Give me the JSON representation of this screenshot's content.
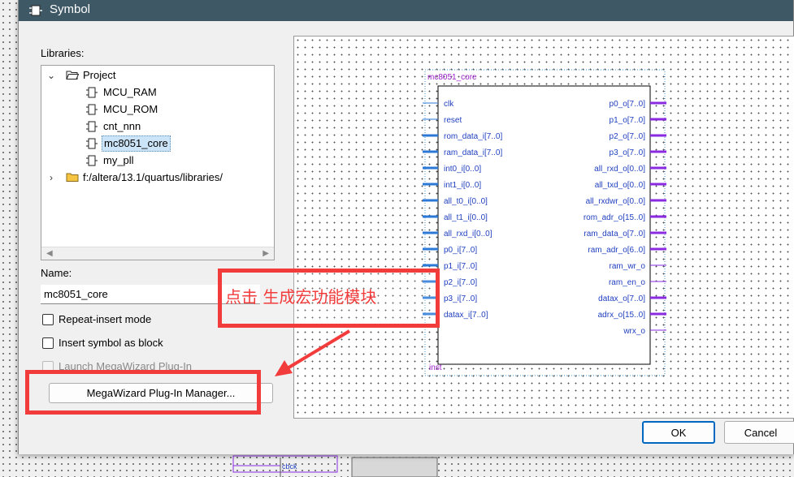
{
  "window": {
    "title": "Symbol"
  },
  "libraries": {
    "label": "Libraries:",
    "tree": [
      {
        "label": "Project",
        "kind": "folder",
        "expanded": true,
        "level": 0
      },
      {
        "label": "MCU_RAM",
        "kind": "symbol",
        "level": 1
      },
      {
        "label": "MCU_ROM",
        "kind": "symbol",
        "level": 1
      },
      {
        "label": "cnt_nnn",
        "kind": "symbol",
        "level": 1
      },
      {
        "label": "mc8051_core",
        "kind": "symbol",
        "level": 1,
        "selected": true
      },
      {
        "label": "my_pll",
        "kind": "symbol",
        "level": 1
      },
      {
        "label": "f:/altera/13.1/quartus/libraries/",
        "kind": "folder",
        "expanded": false,
        "level": 0
      }
    ]
  },
  "name_field": {
    "label": "Name:",
    "value": "mc8051_core"
  },
  "options": {
    "repeat_insert": "Repeat-insert mode",
    "insert_as_block": "Insert symbol as block",
    "launch_megawizard": "Launch MegaWizard Plug-In"
  },
  "buttons": {
    "megawizard": "MegaWizard Plug-In Manager...",
    "ok": "OK",
    "cancel": "Cancel"
  },
  "symbol": {
    "name": "mc8051_core",
    "instance": "inst",
    "inputs": [
      "clk",
      "reset",
      "rom_data_i[7..0]",
      "ram_data_i[7..0]",
      "int0_i[0..0]",
      "int1_i[0..0]",
      "all_t0_i[0..0]",
      "all_t1_i[0..0]",
      "all_rxd_i[0..0]",
      "p0_i[7..0]",
      "p1_i[7..0]",
      "p2_i[7..0]",
      "p3_i[7..0]",
      "datax_i[7..0]"
    ],
    "input_bus": [
      false,
      false,
      true,
      true,
      true,
      true,
      true,
      true,
      true,
      true,
      true,
      true,
      true,
      true
    ],
    "outputs": [
      "p0_o[7..0]",
      "p1_o[7..0]",
      "p2_o[7..0]",
      "p3_o[7..0]",
      "all_rxd_o[0..0]",
      "all_txd_o[0..0]",
      "all_rxdwr_o[0..0]",
      "rom_adr_o[15..0]",
      "ram_data_o[7..0]",
      "ram_adr_o[6..0]",
      "ram_wr_o",
      "ram_en_o",
      "datax_o[7..0]",
      "adrx_o[15..0]",
      "wrx_o"
    ],
    "output_bus": [
      true,
      true,
      true,
      true,
      true,
      true,
      true,
      true,
      true,
      true,
      false,
      false,
      true,
      true,
      false
    ]
  },
  "annotation": {
    "text": "点击 生成宏功能模块"
  },
  "background_schematic": {
    "label": "cbck"
  },
  "colors": {
    "titlebar": "#3f5866",
    "accent": "#0067c0",
    "annotation": "#f23b3b",
    "pin_in": "#2b78d6",
    "pin_out": "#8a2be2",
    "symbol_text": "#1f3fbf",
    "symbol_name": "#9b1fc9"
  }
}
